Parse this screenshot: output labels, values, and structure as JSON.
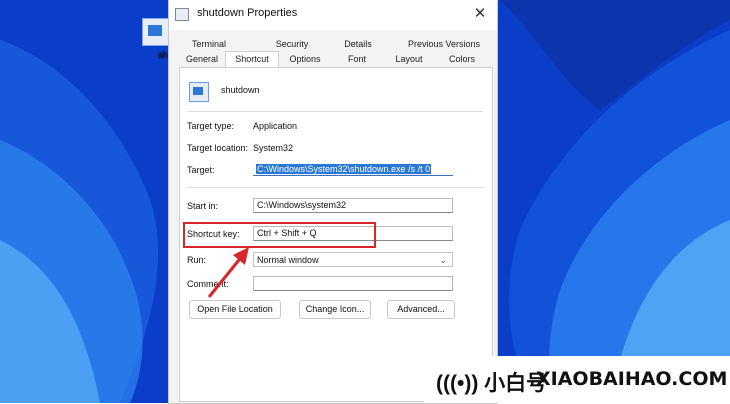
{
  "desktop": {
    "icon_label": "shutd"
  },
  "dialog": {
    "title": "shutdown Properties",
    "close_glyph": "✕",
    "tabs_row1": [
      "Terminal",
      "Security",
      "Details",
      "Previous Versions"
    ],
    "tabs_row2": [
      "General",
      "Shortcut",
      "Options",
      "Font",
      "Layout",
      "Colors"
    ],
    "active_tab": "Shortcut",
    "shortcut_name": "shutdown",
    "target_type_label": "Target type:",
    "target_type_value": "Application",
    "target_location_label": "Target location:",
    "target_location_value": "System32",
    "target_label": "Target:",
    "target_value": "C:\\Windows\\System32\\shutdown.exe /s /t 0",
    "start_in_label": "Start in:",
    "start_in_value": "C:\\Windows\\system32",
    "shortcut_key_label": "Shortcut key:",
    "shortcut_key_value": "Ctrl + Shift + Q",
    "run_label": "Run:",
    "run_value": "Normal window",
    "comment_label": "Comment:",
    "buttons": {
      "open_file_location": "Open File Location",
      "change_icon": "Change Icon...",
      "advanced": "Advanced..."
    }
  },
  "annotation": {
    "highlight_color": "#d8262a"
  },
  "watermark": {
    "logo": "(((•)) 小白号",
    "site": "XIAOBAIHAO.COM"
  }
}
